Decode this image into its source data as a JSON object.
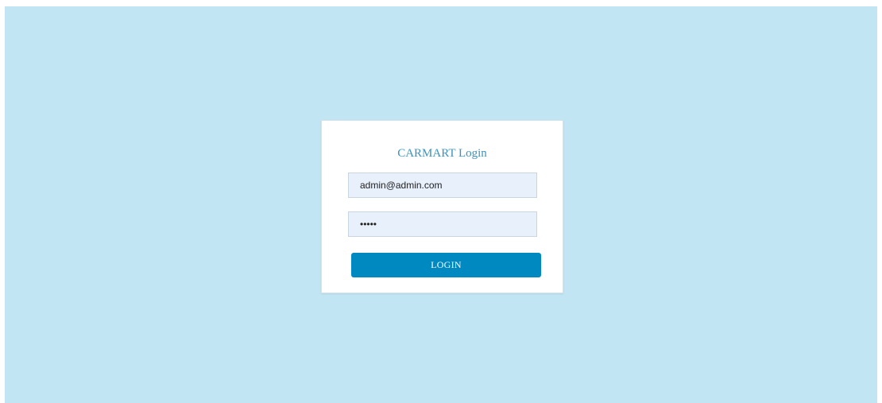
{
  "login": {
    "title": "CARMART Login",
    "email_value": "admin@admin.com",
    "password_value": "admin",
    "button_label": "LOGIN"
  },
  "colors": {
    "background": "#c2e5f3",
    "accent": "#0088c0",
    "title": "#3a93be"
  }
}
